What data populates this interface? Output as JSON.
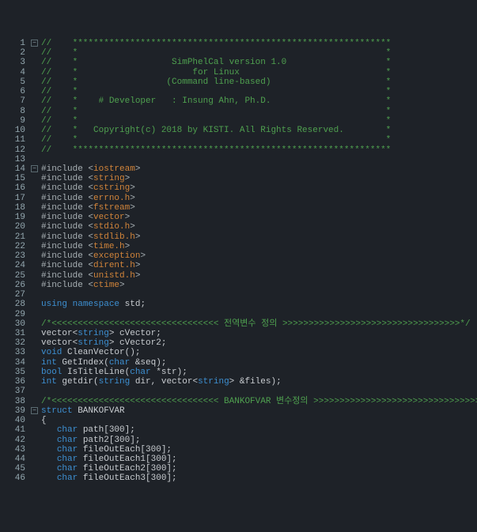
{
  "lines": [
    {
      "n": 1,
      "fold": "-",
      "seg": [
        [
          "c-comment",
          "//    *************************************************************"
        ]
      ]
    },
    {
      "n": 2,
      "fold": "",
      "seg": [
        [
          "c-comment",
          "//    *                                                           *"
        ]
      ]
    },
    {
      "n": 3,
      "fold": "",
      "seg": [
        [
          "c-comment",
          "//    *                  SimPhelCal version 1.0                   *"
        ]
      ]
    },
    {
      "n": 4,
      "fold": "",
      "seg": [
        [
          "c-comment",
          "//    *                      for Linux                            *"
        ]
      ]
    },
    {
      "n": 5,
      "fold": "",
      "seg": [
        [
          "c-comment",
          "//    *                 (Command line-based)                      *"
        ]
      ]
    },
    {
      "n": 6,
      "fold": "",
      "seg": [
        [
          "c-comment",
          "//    *                                                           *"
        ]
      ]
    },
    {
      "n": 7,
      "fold": "",
      "seg": [
        [
          "c-comment",
          "//    *    # Developer   : Insung Ahn, Ph.D.                      *"
        ]
      ]
    },
    {
      "n": 8,
      "fold": "",
      "seg": [
        [
          "c-comment",
          "//    *                                                           *"
        ]
      ]
    },
    {
      "n": 9,
      "fold": "",
      "seg": [
        [
          "c-comment",
          "//    *                                                           *"
        ]
      ]
    },
    {
      "n": 10,
      "fold": "",
      "seg": [
        [
          "c-comment",
          "//    *   Copyright(c) 2018 by KISTI. All Rights Reserved.        *"
        ]
      ]
    },
    {
      "n": 11,
      "fold": "",
      "seg": [
        [
          "c-comment",
          "//    *                                                           *"
        ]
      ]
    },
    {
      "n": 12,
      "fold": "",
      "seg": [
        [
          "c-comment",
          "//    *************************************************************"
        ]
      ]
    },
    {
      "n": 13,
      "fold": "",
      "seg": [
        [
          "c-text",
          ""
        ]
      ]
    },
    {
      "n": 14,
      "fold": "-",
      "seg": [
        [
          "c-pp",
          "#include <"
        ],
        [
          "c-quote",
          "iostream"
        ],
        [
          "c-pp",
          ">"
        ]
      ]
    },
    {
      "n": 15,
      "fold": "",
      "seg": [
        [
          "c-pp",
          "#include <"
        ],
        [
          "c-quote",
          "string"
        ],
        [
          "c-pp",
          ">"
        ]
      ]
    },
    {
      "n": 16,
      "fold": "",
      "seg": [
        [
          "c-pp",
          "#include <"
        ],
        [
          "c-quote",
          "cstring"
        ],
        [
          "c-pp",
          ">"
        ]
      ]
    },
    {
      "n": 17,
      "fold": "",
      "seg": [
        [
          "c-pp",
          "#include <"
        ],
        [
          "c-quote",
          "errno.h"
        ],
        [
          "c-pp",
          ">"
        ]
      ]
    },
    {
      "n": 18,
      "fold": "",
      "seg": [
        [
          "c-pp",
          "#include <"
        ],
        [
          "c-quote",
          "fstream"
        ],
        [
          "c-pp",
          ">"
        ]
      ]
    },
    {
      "n": 19,
      "fold": "",
      "seg": [
        [
          "c-pp",
          "#include <"
        ],
        [
          "c-quote",
          "vector"
        ],
        [
          "c-pp",
          ">"
        ]
      ]
    },
    {
      "n": 20,
      "fold": "",
      "seg": [
        [
          "c-pp",
          "#include <"
        ],
        [
          "c-quote",
          "stdio.h"
        ],
        [
          "c-pp",
          ">"
        ]
      ]
    },
    {
      "n": 21,
      "fold": "",
      "seg": [
        [
          "c-pp",
          "#include <"
        ],
        [
          "c-quote",
          "stdlib.h"
        ],
        [
          "c-pp",
          ">"
        ]
      ]
    },
    {
      "n": 22,
      "fold": "",
      "seg": [
        [
          "c-pp",
          "#include <"
        ],
        [
          "c-quote",
          "time.h"
        ],
        [
          "c-pp",
          ">"
        ]
      ]
    },
    {
      "n": 23,
      "fold": "",
      "seg": [
        [
          "c-pp",
          "#include <"
        ],
        [
          "c-quote",
          "exception"
        ],
        [
          "c-pp",
          ">"
        ]
      ]
    },
    {
      "n": 24,
      "fold": "",
      "seg": [
        [
          "c-pp",
          "#include <"
        ],
        [
          "c-quote",
          "dirent.h"
        ],
        [
          "c-pp",
          ">"
        ]
      ]
    },
    {
      "n": 25,
      "fold": "",
      "seg": [
        [
          "c-pp",
          "#include <"
        ],
        [
          "c-quote",
          "unistd.h"
        ],
        [
          "c-pp",
          ">"
        ]
      ]
    },
    {
      "n": 26,
      "fold": "",
      "seg": [
        [
          "c-pp",
          "#include <"
        ],
        [
          "c-quote",
          "ctime"
        ],
        [
          "c-pp",
          ">"
        ]
      ]
    },
    {
      "n": 27,
      "fold": "",
      "seg": [
        [
          "c-text",
          ""
        ]
      ]
    },
    {
      "n": 28,
      "fold": "",
      "seg": [
        [
          "c-kw",
          "using"
        ],
        [
          "c-text",
          " "
        ],
        [
          "c-kw",
          "namespace"
        ],
        [
          "c-text",
          " std;"
        ]
      ]
    },
    {
      "n": 29,
      "fold": "",
      "seg": [
        [
          "c-text",
          ""
        ]
      ]
    },
    {
      "n": 30,
      "fold": "",
      "seg": [
        [
          "c-comment",
          "/*<<<<<<<<<<<<<<<<<<<<<<<<<<<<<<<< 전역변수 정의 >>>>>>>>>>>>>>>>>>>>>>>>>>>>>>>>>>*/"
        ]
      ]
    },
    {
      "n": 31,
      "fold": "",
      "seg": [
        [
          "c-text",
          "vector<"
        ],
        [
          "c-kw",
          "string"
        ],
        [
          "c-text",
          "> cVector;"
        ]
      ]
    },
    {
      "n": 32,
      "fold": "",
      "seg": [
        [
          "c-text",
          "vector<"
        ],
        [
          "c-kw",
          "string"
        ],
        [
          "c-text",
          "> cVector2;"
        ]
      ]
    },
    {
      "n": 33,
      "fold": "",
      "seg": [
        [
          "c-kw",
          "void"
        ],
        [
          "c-text",
          " CleanVector();"
        ]
      ]
    },
    {
      "n": 34,
      "fold": "",
      "seg": [
        [
          "c-kw",
          "int"
        ],
        [
          "c-text",
          " GetIndex("
        ],
        [
          "c-kw",
          "char"
        ],
        [
          "c-text",
          " &seq);"
        ]
      ]
    },
    {
      "n": 35,
      "fold": "",
      "seg": [
        [
          "c-kw",
          "bool"
        ],
        [
          "c-text",
          " IsTitleLine("
        ],
        [
          "c-kw",
          "char"
        ],
        [
          "c-text",
          " *str);"
        ]
      ]
    },
    {
      "n": 36,
      "fold": "",
      "seg": [
        [
          "c-kw",
          "int"
        ],
        [
          "c-text",
          " getdir("
        ],
        [
          "c-kw",
          "string"
        ],
        [
          "c-text",
          " dir, vector<"
        ],
        [
          "c-kw",
          "string"
        ],
        [
          "c-text",
          "> &files);"
        ]
      ]
    },
    {
      "n": 37,
      "fold": "",
      "seg": [
        [
          "c-text",
          ""
        ]
      ]
    },
    {
      "n": 38,
      "fold": "",
      "seg": [
        [
          "c-comment",
          "/*<<<<<<<<<<<<<<<<<<<<<<<<<<<<<<<< BANKOFVAR 변수정의 >>>>>>>>>>>>>>>>>>>>>>>>>>>>>>>>>>*/"
        ]
      ]
    },
    {
      "n": 39,
      "fold": "-",
      "seg": [
        [
          "c-kw",
          "struct"
        ],
        [
          "c-text",
          " BANKOFVAR"
        ]
      ]
    },
    {
      "n": 40,
      "fold": "",
      "seg": [
        [
          "c-text",
          "{"
        ]
      ]
    },
    {
      "n": 41,
      "fold": "",
      "seg": [
        [
          "c-text",
          "   "
        ],
        [
          "c-kw",
          "char"
        ],
        [
          "c-text",
          " path[300];"
        ]
      ]
    },
    {
      "n": 42,
      "fold": "",
      "seg": [
        [
          "c-text",
          "   "
        ],
        [
          "c-kw",
          "char"
        ],
        [
          "c-text",
          " path2[300];"
        ]
      ]
    },
    {
      "n": 43,
      "fold": "",
      "seg": [
        [
          "c-text",
          "   "
        ],
        [
          "c-kw",
          "char"
        ],
        [
          "c-text",
          " fileOutEach[300];"
        ]
      ]
    },
    {
      "n": 44,
      "fold": "",
      "seg": [
        [
          "c-text",
          "   "
        ],
        [
          "c-kw",
          "char"
        ],
        [
          "c-text",
          " fileOutEach1[300];"
        ]
      ]
    },
    {
      "n": 45,
      "fold": "",
      "seg": [
        [
          "c-text",
          "   "
        ],
        [
          "c-kw",
          "char"
        ],
        [
          "c-text",
          " fileOutEach2[300];"
        ]
      ]
    },
    {
      "n": 46,
      "fold": "",
      "seg": [
        [
          "c-text",
          "   "
        ],
        [
          "c-kw",
          "char"
        ],
        [
          "c-text",
          " fileOutEach3[300];"
        ]
      ]
    }
  ]
}
